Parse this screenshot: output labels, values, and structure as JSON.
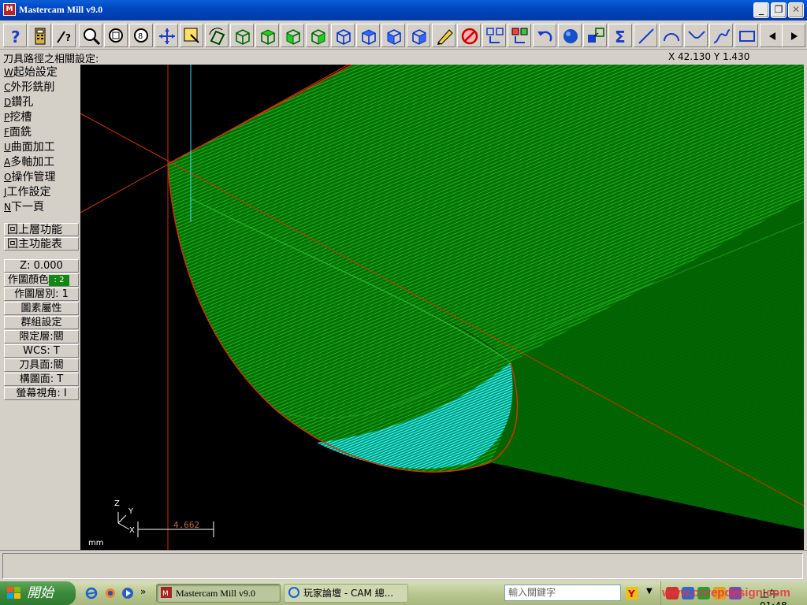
{
  "window": {
    "title": "Mastercam Mill v9.0",
    "app_icon": "mastercam-icon"
  },
  "toolbar": {
    "buttons": [
      "help",
      "calculator",
      "analyze",
      "zoom",
      "unzoom",
      "zoom-box",
      "pan",
      "screen-select",
      "gview-3d",
      "gview-top",
      "gview-front",
      "gview-side",
      "gview-iso",
      "cplane-top",
      "cplane-front",
      "cplane-side",
      "cplane-iso",
      "edit",
      "delete",
      "copy",
      "transform",
      "undo",
      "shade",
      "save-view",
      "sum",
      "line",
      "arc",
      "fillet",
      "spline",
      "rectangle",
      "scroll-left",
      "scroll-right"
    ]
  },
  "prompt": {
    "text": "刀具路徑之相關設定:",
    "coords": "X 42.130   Y 1.430"
  },
  "menu": {
    "items": [
      {
        "key": "W",
        "label": "起始設定"
      },
      {
        "key": "C",
        "label": "外形銑削"
      },
      {
        "key": "D",
        "label": "鑽孔"
      },
      {
        "key": "P",
        "label": "挖槽"
      },
      {
        "key": "F",
        "label": "面銑"
      },
      {
        "key": "U",
        "label": "曲面加工"
      },
      {
        "key": "A",
        "label": "多軸加工"
      },
      {
        "key": "O",
        "label": "操作管理"
      },
      {
        "key": "J",
        "label": "工作設定"
      },
      {
        "key": "N",
        "label": "下一頁"
      }
    ],
    "back_upper": "回上層功能",
    "main_menu": "回主功能表"
  },
  "secondary": {
    "z": "Z:  0.000",
    "color": "作圖顏色",
    "color_value": ": 2",
    "level": "作圖層別: 1",
    "attributes": "圖素屬性",
    "groups": "群組設定",
    "mask": "限定層:關",
    "wcs": "WCS:  T",
    "tplane": "刀具面:關",
    "cplane": "構圖面: T",
    "gview": "螢幕視角: I"
  },
  "viewport": {
    "units": "mm",
    "scale_value": "4.662",
    "axis_labels": {
      "z": "Z",
      "y": "Y",
      "x": "X"
    },
    "colors": {
      "background": "#000000",
      "toolpath": "#008a00",
      "toolpath_highlight": "#00ffff",
      "boundary": "#cc3300"
    }
  },
  "taskbar": {
    "start": "開始",
    "tasks": [
      {
        "label": "Mastercam Mill v9.0",
        "active": true
      },
      {
        "label": "玩家論壇 - CAM 總...",
        "active": false
      }
    ],
    "search_placeholder": "輸入關鍵字",
    "clock": "上午 01:48",
    "watermark": "www.cnrepdesign.com"
  }
}
